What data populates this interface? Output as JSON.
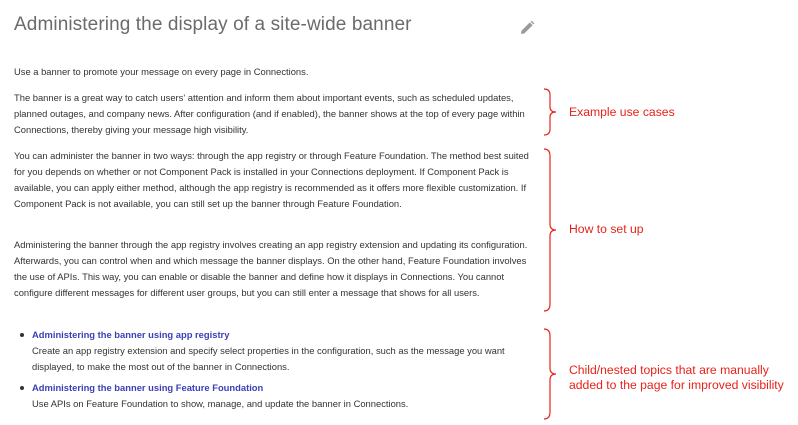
{
  "page": {
    "title": "Administering the display of a site-wide banner",
    "edit_icon": "pencil-icon"
  },
  "paragraphs": [
    "Use a banner to promote your message on every page in Connections.",
    "The banner is a great way to catch users' attention and inform them about important events, such as scheduled updates, planned outages, and company news. After configuration (and if enabled), the banner shows at the top of every page within Connections, thereby giving your message high visibility.",
    "You can administer the banner in two ways: through the app registry or through Feature Foundation. The method best suited for you depends on whether or not Component Pack is installed in your Connections deployment. If Component Pack is available, you can apply either method, although the app registry is recommended as it offers more flexible customization. If Component Pack is not available, you can still set up the banner through Feature Foundation.",
    "Administering the banner through the app registry involves creating an app registry extension and updating its configuration. Afterwards, you can control when and which message the banner displays. On the other hand, Feature Foundation involves the use of APIs. This way, you can enable or disable the banner and define how it displays in Connections. You cannot configure different messages for different user groups, but you can still enter a message that shows for all users."
  ],
  "child_topics": [
    {
      "link": "Administering the banner using app registry",
      "description": "Create an app registry extension and specify select properties in the configuration, such as the message you want displayed, to make the most out of the banner in Connections."
    },
    {
      "link": "Administering the banner using Feature Foundation",
      "description": "Use APIs on Feature Foundation to show, manage, and update the banner in Connections."
    }
  ],
  "annotations": {
    "color": "#e8221a",
    "example_use_cases": "Example use cases",
    "how_to_set_up": "How to set up",
    "child_topics_line1": "Child/nested topics that are manually",
    "child_topics_line2": "added to the page for improved visibility"
  },
  "colors": {
    "title": "#6b6b6b",
    "link": "#3b3fb6",
    "annotation": "#e8221a"
  }
}
